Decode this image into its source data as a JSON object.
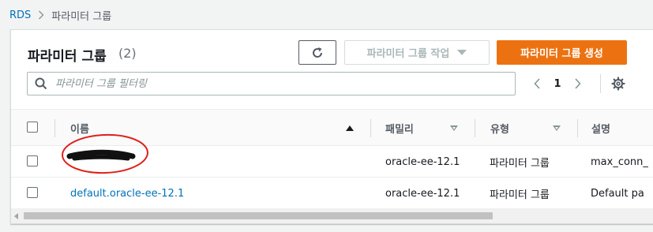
{
  "breadcrumb": {
    "root": "RDS",
    "current": "파라미터 그룹"
  },
  "panel": {
    "title": "파라미터 그룹",
    "count": "(2)",
    "actions_label": "파라미터 그룹 작업",
    "create_label": "파라미터 그룹 생성"
  },
  "search": {
    "placeholder": "파라미터 그룹 필터링"
  },
  "pagination": {
    "current_page": "1"
  },
  "columns": [
    "이름",
    "패밀리",
    "유형",
    "설명"
  ],
  "rows": [
    {
      "name": "",
      "family": "oracle-ee-12.1",
      "type": "파라미터 그룹",
      "description": "max_conn_"
    },
    {
      "name": "default.oracle-ee-12.1",
      "family": "oracle-ee-12.1",
      "type": "파라미터 그룹",
      "description": "Default pa"
    }
  ],
  "colors": {
    "accent": "#ec7211",
    "link": "#0073bb"
  },
  "icons": [
    "chevron-right-icon",
    "refresh-icon",
    "caret-down-icon",
    "search-icon",
    "chevron-left-icon",
    "gear-icon",
    "sort-ascending-icon",
    "sort-descending-icon"
  ]
}
